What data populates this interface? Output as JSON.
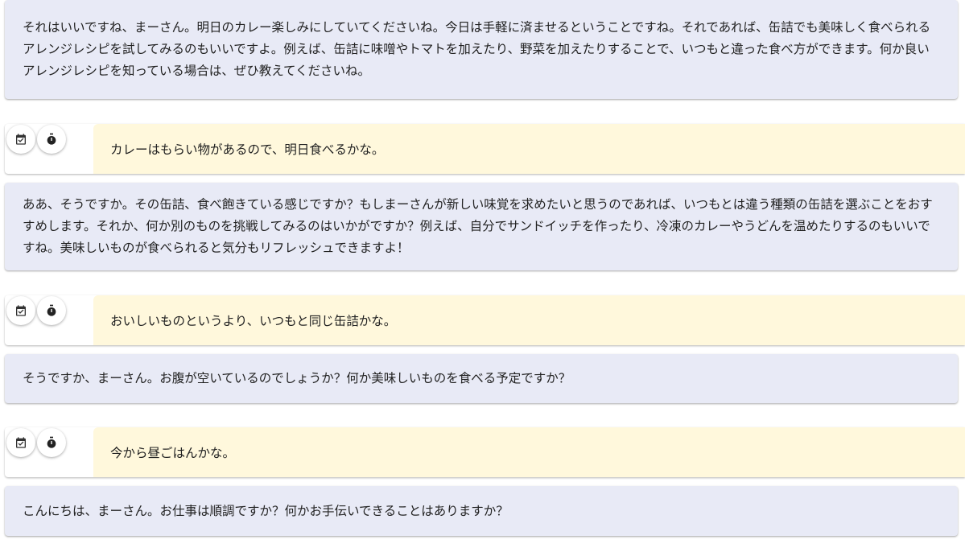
{
  "messages": [
    {
      "role": "assistant",
      "text": "それはいいですね、まーさん。明日のカレー楽しみにしていてくださいね。今日は手軽に済ませるということですね。それであれば、缶詰でも美味しく食べられるアレンジレシピを試してみるのもいいですよ。例えば、缶詰に味噌やトマトを加えたり、野菜を加えたりすることで、いつもと違った食べ方ができます。何か良いアレンジレシピを知っている場合は、ぜひ教えてくださいね。"
    },
    {
      "role": "user",
      "text": "カレーはもらい物があるので、明日食べるかな。",
      "icons": [
        "calendar-check-icon",
        "stopwatch-icon"
      ]
    },
    {
      "role": "assistant",
      "text": "ああ、そうですか。その缶詰、食べ飽きている感じですか？もしまーさんが新しい味覚を求めたいと思うのであれば、いつもとは違う種類の缶詰を選ぶことをおすすめします。それか、何か別のものを挑戦してみるのはいかがですか？例えば、自分でサンドイッチを作ったり、冷凍のカレーやうどんを温めたりするのもいいですね。美味しいものが食べられると気分もリフレッシュできますよ！"
    },
    {
      "role": "user",
      "text": "おいしいものというより、いつもと同じ缶詰かな。",
      "icons": [
        "calendar-check-icon",
        "stopwatch-icon"
      ]
    },
    {
      "role": "assistant",
      "text": "そうですか、まーさん。お腹が空いているのでしょうか？何か美味しいものを食べる予定ですか？"
    },
    {
      "role": "user",
      "text": "今から昼ごはんかな。",
      "icons": [
        "calendar-check-icon",
        "stopwatch-icon"
      ]
    },
    {
      "role": "assistant",
      "text": "こんにちは、まーさん。お仕事は順調ですか？何かお手伝いできることはありますか？"
    }
  ]
}
